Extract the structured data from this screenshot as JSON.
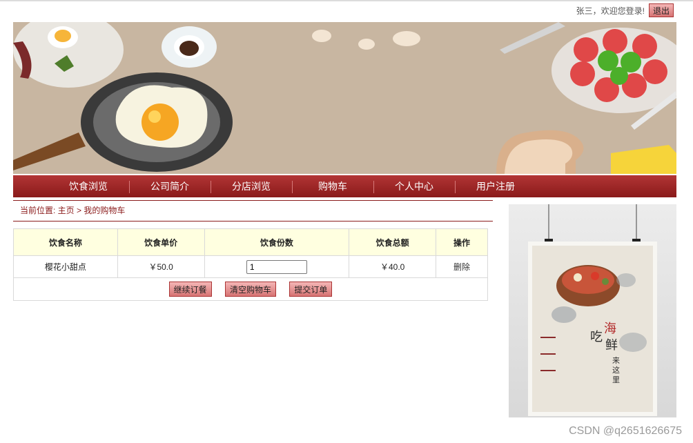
{
  "header": {
    "welcome_text": "张三，欢迎您登录!",
    "logout_label": "退出"
  },
  "nav": {
    "items": [
      "饮食浏览",
      "公司简介",
      "分店浏览",
      "购物车",
      "个人中心",
      "用户注册"
    ]
  },
  "breadcrumb": {
    "prefix": "当前位置: ",
    "home": "主页",
    "separator": " > ",
    "current": "我的购物车"
  },
  "cart": {
    "headers": [
      "饮食名称",
      "饮食单价",
      "饮食份数",
      "饮食总额",
      "操作"
    ],
    "rows": [
      {
        "name": "樱花小甜点",
        "price": "￥50.0",
        "quantity": "1",
        "total": "￥40.0",
        "action": "删除"
      }
    ],
    "buttons": {
      "continue": "继续订餐",
      "clear": "清空购物车",
      "submit": "提交订单"
    }
  },
  "poster": {
    "title_chars": [
      "吃",
      "海",
      "鲜",
      "来",
      "这",
      "里"
    ]
  },
  "watermark": "CSDN @q2651626675",
  "colors": {
    "nav_red": "#a02626",
    "header_yellow": "#ffffe0",
    "banner_beige": "#c8b6a1"
  }
}
